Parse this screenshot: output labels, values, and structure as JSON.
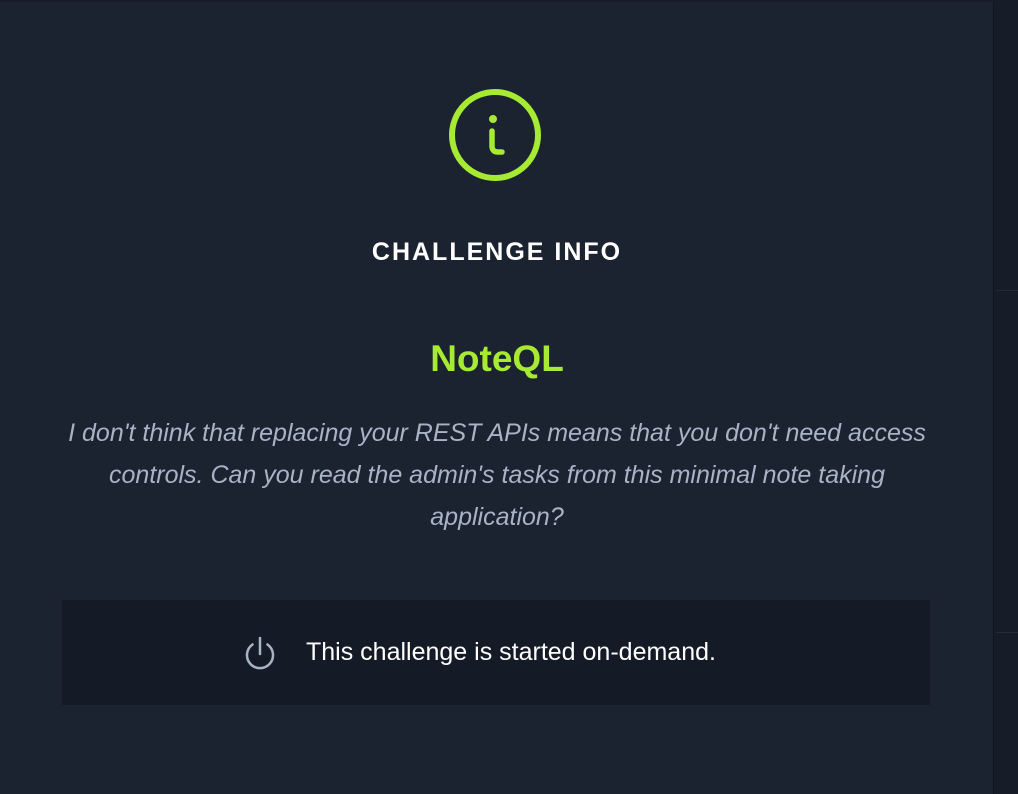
{
  "modal": {
    "heading": "CHALLENGE INFO",
    "icon": "info-circle-icon",
    "accent_color": "#a6ea32",
    "background_color": "#1b2230"
  },
  "challenge": {
    "name": "NoteQL",
    "description": "I don't think that replacing your REST APIs means that you don't need access controls. Can you read the admin's tasks from this minimal note taking application?"
  },
  "status": {
    "icon": "power-icon",
    "text": "This challenge is started on-demand."
  }
}
